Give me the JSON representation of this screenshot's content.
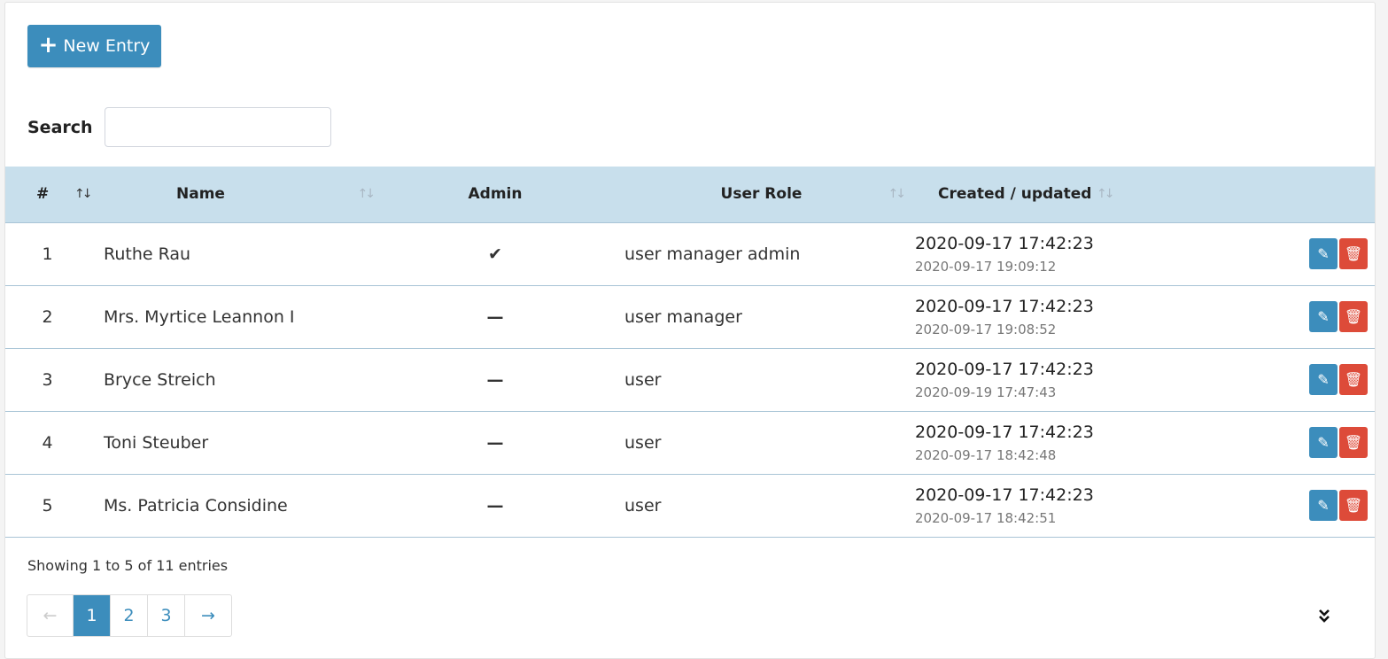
{
  "toolbar": {
    "new_entry_label": "New Entry"
  },
  "search": {
    "label": "Search",
    "value": "",
    "placeholder": ""
  },
  "table": {
    "headers": {
      "num": "#",
      "name": "Name",
      "admin": "Admin",
      "role": "User Role",
      "created": "Created / updated"
    },
    "rows": [
      {
        "num": "1",
        "name": "Ruthe Rau",
        "admin": "✔",
        "role": "user manager admin",
        "created": "2020-09-17 17:42:23",
        "updated": "2020-09-17 19:09:12"
      },
      {
        "num": "2",
        "name": "Mrs. Myrtice Leannon I",
        "admin": "—",
        "role": "user manager",
        "created": "2020-09-17 17:42:23",
        "updated": "2020-09-17 19:08:52"
      },
      {
        "num": "3",
        "name": "Bryce Streich",
        "admin": "—",
        "role": "user",
        "created": "2020-09-17 17:42:23",
        "updated": "2020-09-19 17:47:43"
      },
      {
        "num": "4",
        "name": "Toni Steuber",
        "admin": "—",
        "role": "user",
        "created": "2020-09-17 17:42:23",
        "updated": "2020-09-17 18:42:48"
      },
      {
        "num": "5",
        "name": "Ms. Patricia Considine",
        "admin": "—",
        "role": "user",
        "created": "2020-09-17 17:42:23",
        "updated": "2020-09-17 18:42:51"
      }
    ]
  },
  "footer": {
    "info": "Showing 1 to 5 of 11 entries"
  },
  "pagination": {
    "prev": "←",
    "pages": [
      "1",
      "2",
      "3"
    ],
    "active": "1",
    "next": "→"
  },
  "colors": {
    "primary": "#3c8dbc",
    "danger": "#dd4b39",
    "header_bg": "#c8dfec",
    "link": "#4a83b0"
  },
  "icons": {
    "edit": "pencil-icon",
    "delete": "trash-icon",
    "expand": "double-chevron-down-icon",
    "add": "plus-icon"
  }
}
